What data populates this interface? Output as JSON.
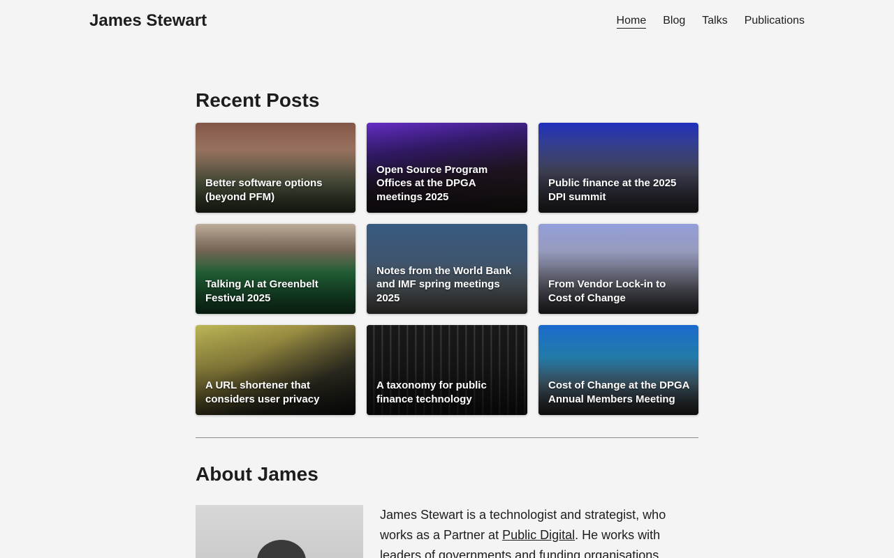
{
  "header": {
    "site_title": "James Stewart",
    "nav": [
      {
        "label": "Home",
        "active": true
      },
      {
        "label": "Blog",
        "active": false
      },
      {
        "label": "Talks",
        "active": false
      },
      {
        "label": "Publications",
        "active": false
      }
    ]
  },
  "recent_posts": {
    "heading": "Recent Posts",
    "posts": [
      {
        "title": "Better software options (beyond PFM)"
      },
      {
        "title": "Open Source Program Offices at the DPGA meetings 2025"
      },
      {
        "title": "Public finance at the 2025 DPI summit"
      },
      {
        "title": "Talking AI at Greenbelt Festival 2025"
      },
      {
        "title": "Notes from the World Bank and IMF spring meetings 2025"
      },
      {
        "title": "From Vendor Lock-in to Cost of Change"
      },
      {
        "title": "A URL shortener that considers user privacy"
      },
      {
        "title": "A taxonomy for public finance technology"
      },
      {
        "title": "Cost of Change at the DPGA Annual Members Meeting"
      }
    ]
  },
  "about": {
    "heading": "About James",
    "text_before": "James Stewart is a technologist and strategist, who works as a Partner at ",
    "link_label": "Public Digital",
    "text_after": ". He works with leaders of governments and funding organisations"
  }
}
